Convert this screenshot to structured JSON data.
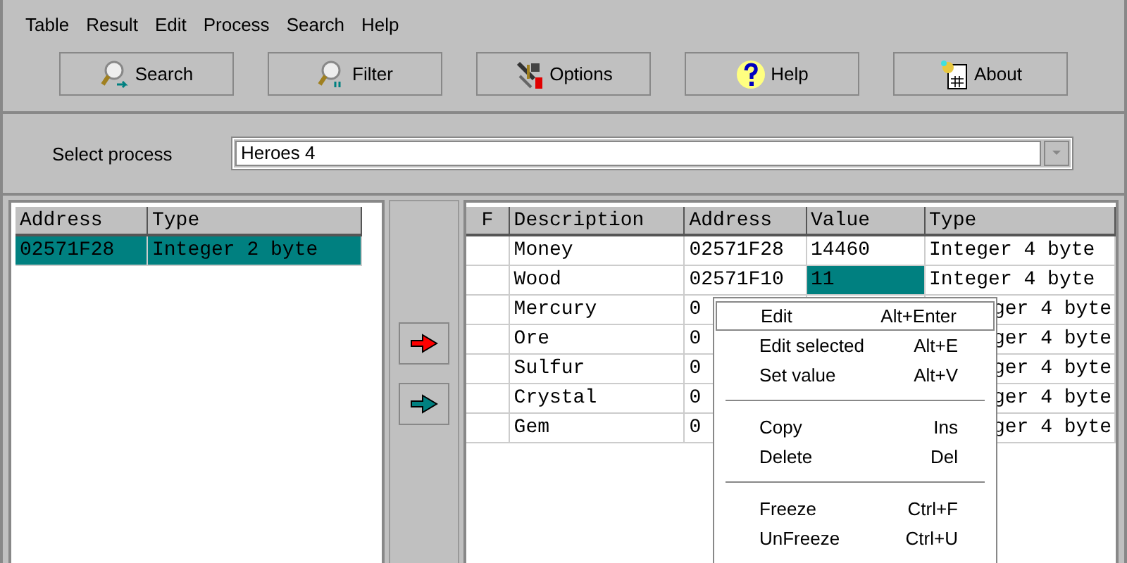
{
  "menu_bar": [
    "Table",
    "Result",
    "Edit",
    "Process",
    "Search",
    "Help"
  ],
  "toolbar": [
    {
      "kind": "search",
      "label": "Search"
    },
    {
      "kind": "filter",
      "label": "Filter"
    },
    {
      "kind": "options",
      "label": "Options"
    },
    {
      "kind": "help",
      "label": "Help"
    },
    {
      "kind": "about",
      "label": "About"
    }
  ],
  "process_selector": {
    "label": "Select process",
    "value": "Heroes 4"
  },
  "found_list": {
    "columns": [
      "Address",
      "Type"
    ],
    "rows": [
      {
        "cells": [
          "02571F28",
          "Integer 2 byte"
        ],
        "selected": true
      }
    ]
  },
  "transfer_buttons": [
    {
      "color": "#ff0000"
    },
    {
      "color": "#008080"
    }
  ],
  "cheat_table": {
    "columns": [
      "F",
      "Description",
      "Address",
      "Value",
      "Type"
    ],
    "rows": [
      {
        "description": "Money",
        "address": "02571F28",
        "value": "14460",
        "type": "Integer 4 byte",
        "selected": false,
        "clipped": false
      },
      {
        "description": "Wood",
        "address": "02571F10",
        "value": "11",
        "type": "Integer 4 byte",
        "selected": true,
        "clipped": false
      },
      {
        "description": "Mercury",
        "address": "0",
        "type": "ger 4 byte",
        "clipped": true
      },
      {
        "description": "Ore",
        "address": "0",
        "type": "ger 4 byte",
        "clipped": true
      },
      {
        "description": "Sulfur",
        "address": "0",
        "type": "ger 4 byte",
        "clipped": true
      },
      {
        "description": "Crystal",
        "address": "0",
        "type": "ger 4 byte",
        "clipped": true
      },
      {
        "description": "Gem",
        "address": "0",
        "type": "ger 4 byte",
        "clipped": true
      }
    ]
  },
  "context_menu": [
    {
      "kind": "item",
      "label": "Edit",
      "shortcut": "Alt+Enter",
      "selected": true
    },
    {
      "kind": "item",
      "label": "Edit selected",
      "shortcut": "Alt+E",
      "selected": false
    },
    {
      "kind": "item",
      "label": "Set value",
      "shortcut": "Alt+V",
      "selected": false
    },
    {
      "kind": "separator"
    },
    {
      "kind": "item",
      "label": "Copy",
      "shortcut": "Ins",
      "selected": false
    },
    {
      "kind": "item",
      "label": "Delete",
      "shortcut": "Del",
      "selected": false
    },
    {
      "kind": "separator"
    },
    {
      "kind": "item",
      "label": "Freeze",
      "shortcut": "Ctrl+F",
      "selected": false
    },
    {
      "kind": "item",
      "label": "UnFreeze",
      "shortcut": "Ctrl+U",
      "selected": false
    }
  ]
}
